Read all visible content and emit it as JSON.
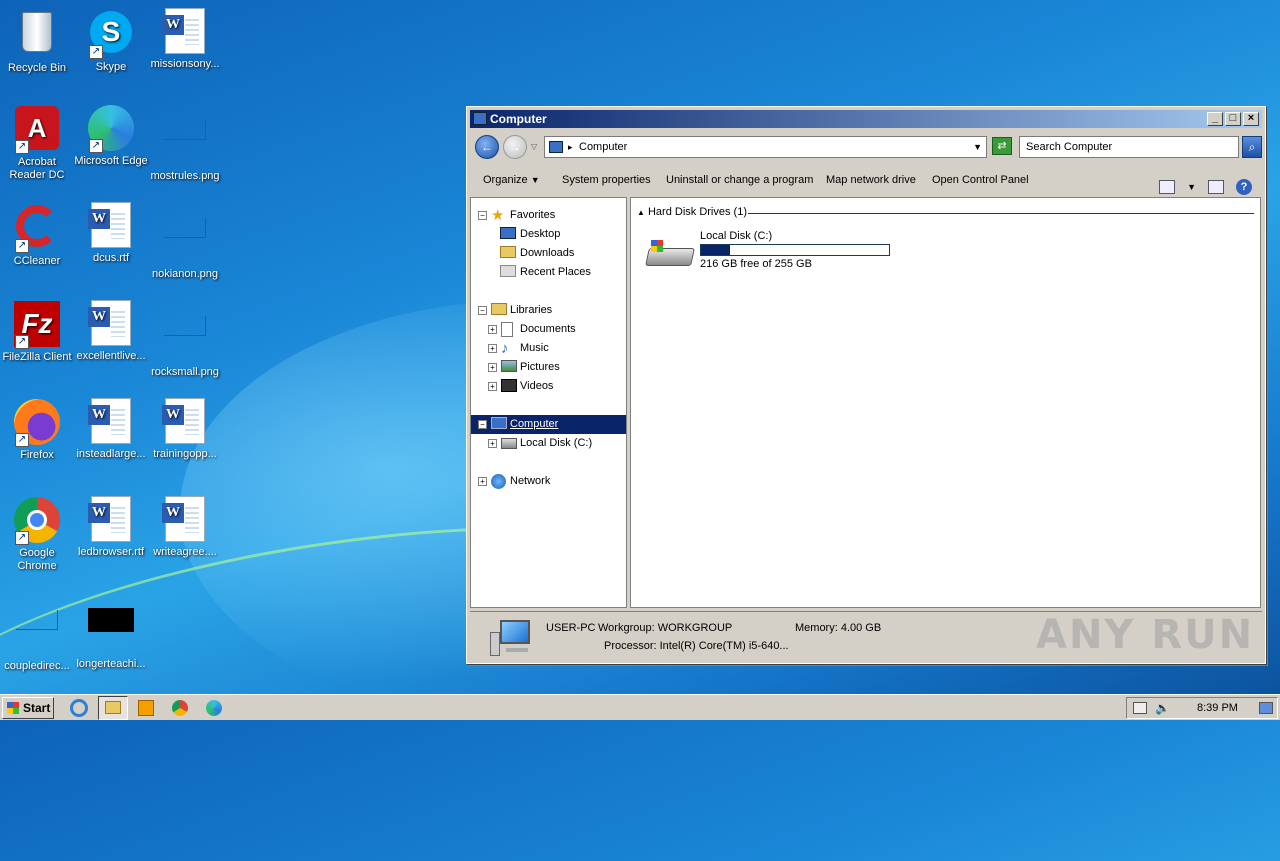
{
  "desktop": {
    "icons": [
      {
        "label": "Recycle Bin",
        "icon": "recycle-bin-icon"
      },
      {
        "label": "Skype",
        "icon": "skype-icon"
      },
      {
        "label": "missionsony...",
        "icon": "word-document-icon"
      },
      {
        "label": "Acrobat Reader DC",
        "icon": "acrobat-icon"
      },
      {
        "label": "Microsoft Edge",
        "icon": "edge-icon"
      },
      {
        "label": "mostrules.png",
        "icon": "image-file-icon"
      },
      {
        "label": "CCleaner",
        "icon": "ccleaner-icon"
      },
      {
        "label": "dcus.rtf",
        "icon": "word-document-icon"
      },
      {
        "label": "nokianon.png",
        "icon": "image-file-icon"
      },
      {
        "label": "FileZilla Client",
        "icon": "filezilla-icon"
      },
      {
        "label": "excellentlive...",
        "icon": "word-document-icon"
      },
      {
        "label": "rocksmall.png",
        "icon": "image-file-icon"
      },
      {
        "label": "Firefox",
        "icon": "firefox-icon"
      },
      {
        "label": "insteadlarge...",
        "icon": "word-document-icon"
      },
      {
        "label": "trainingopp...",
        "icon": "word-document-icon"
      },
      {
        "label": "Google Chrome",
        "icon": "chrome-icon"
      },
      {
        "label": "ledbrowser.rtf",
        "icon": "word-document-icon"
      },
      {
        "label": "writeagree....",
        "icon": "word-document-icon"
      },
      {
        "label": "coupledirec...",
        "icon": "image-file-icon"
      },
      {
        "label": "longerteachi...",
        "icon": "image-file-icon"
      }
    ]
  },
  "window": {
    "title": "Computer",
    "address": "Computer",
    "search_placeholder": "Search Computer",
    "commands": {
      "organize": "Organize",
      "system_properties": "System properties",
      "uninstall": "Uninstall or change a program",
      "map_drive": "Map network drive",
      "control_panel": "Open Control Panel"
    },
    "nav": {
      "favorites": "Favorites",
      "desktop": "Desktop",
      "downloads": "Downloads",
      "recent": "Recent Places",
      "libraries": "Libraries",
      "documents": "Documents",
      "music": "Music",
      "pictures": "Pictures",
      "videos": "Videos",
      "computer": "Computer",
      "local_disk": "Local Disk (C:)",
      "network": "Network"
    },
    "content": {
      "group_title": "Hard Disk Drives (1)",
      "drive_name": "Local Disk (C:)",
      "drive_free": "216 GB free of 255 GB",
      "drive_used_fraction": 0.153
    },
    "details": {
      "pc_name": "USER-PC",
      "workgroup": "Workgroup: WORKGROUP",
      "memory": "Memory: 4.00 GB",
      "processor": "Processor: Intel(R) Core(TM) i5-640..."
    }
  },
  "taskbar": {
    "start": "Start",
    "clock": "8:39 PM"
  },
  "watermark": "ANY RUN"
}
